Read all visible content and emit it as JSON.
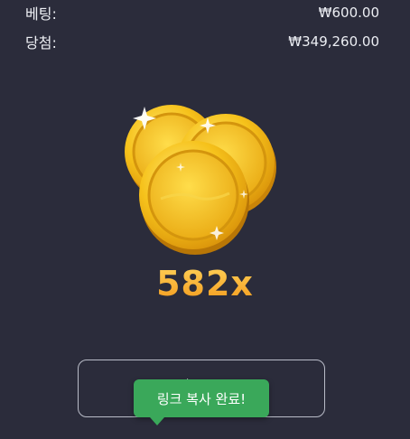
{
  "summary": {
    "bet_label": "베팅:",
    "bet_value": "₩600.00",
    "win_label": "당첨:",
    "win_value": "₩349,260.00"
  },
  "result": {
    "multiplier": "582x",
    "icon": "gold-coins-icon"
  },
  "action": {
    "label": "",
    "icon": "play-icon"
  },
  "toast": {
    "message": "링크 복사 완료!"
  },
  "colors": {
    "background": "#2b2c3b",
    "multiplier": "#f4a62a",
    "toast": "#3aa85a",
    "coin": "#f6c21b"
  }
}
